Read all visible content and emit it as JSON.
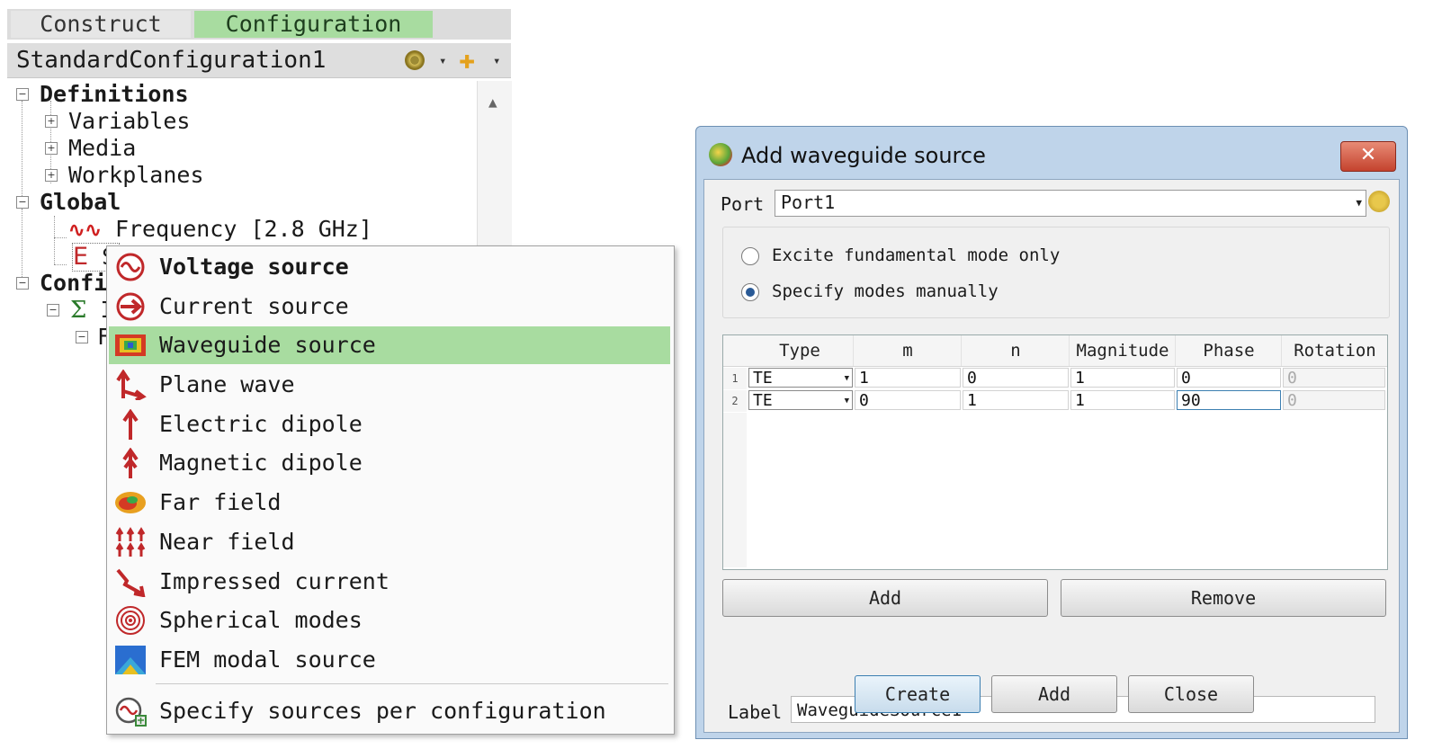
{
  "tabs": {
    "construct": "Construct",
    "configuration": "Configuration"
  },
  "config_bar": {
    "title": "StandardConfiguration1"
  },
  "tree": {
    "definitions": "Definitions",
    "variables": "Variables",
    "media": "Media",
    "workplanes": "Workplanes",
    "global": "Global",
    "frequency": "Frequency [2.8 GHz]",
    "sources_partial": "S",
    "config_partial": "Confi",
    "sigma_partial": "I",
    "sub_partial": "F"
  },
  "context_menu": {
    "items": [
      {
        "label": "Voltage source",
        "icon": "voltage-source-icon",
        "bold": true
      },
      {
        "label": "Current source",
        "icon": "current-source-icon"
      },
      {
        "label": "Waveguide source",
        "icon": "waveguide-source-icon",
        "active": true
      },
      {
        "label": "Plane wave",
        "icon": "plane-wave-icon"
      },
      {
        "label": "Electric dipole",
        "icon": "electric-dipole-icon"
      },
      {
        "label": "Magnetic dipole",
        "icon": "magnetic-dipole-icon"
      },
      {
        "label": "Far field",
        "icon": "far-field-icon"
      },
      {
        "label": "Near field",
        "icon": "near-field-icon"
      },
      {
        "label": "Impressed current",
        "icon": "impressed-current-icon"
      },
      {
        "label": "Spherical modes",
        "icon": "spherical-modes-icon"
      },
      {
        "label": "FEM modal source",
        "icon": "fem-modal-source-icon"
      }
    ],
    "footer": "Specify sources per configuration",
    "active_color": "#a8dca0"
  },
  "dialog": {
    "title": "Add waveguide source",
    "close": "✕",
    "port_label": "Port",
    "port_value": "Port1",
    "mode_fundamental": "Excite fundamental mode only",
    "mode_manual": "Specify modes manually",
    "columns": [
      "Type",
      "m",
      "n",
      "Magnitude",
      "Phase",
      "Rotation"
    ],
    "rows": [
      {
        "num": "1",
        "type": "TE",
        "m": "1",
        "n": "0",
        "magnitude": "1",
        "phase": "0",
        "rotation": "0"
      },
      {
        "num": "2",
        "type": "TE",
        "m": "0",
        "n": "1",
        "magnitude": "1",
        "phase": "90",
        "rotation": "0"
      }
    ],
    "add_row": "Add",
    "remove_row": "Remove",
    "label_label": "Label",
    "label_value": "WaveguideSource1",
    "create": "Create",
    "add": "Add",
    "close_btn": "Close"
  }
}
